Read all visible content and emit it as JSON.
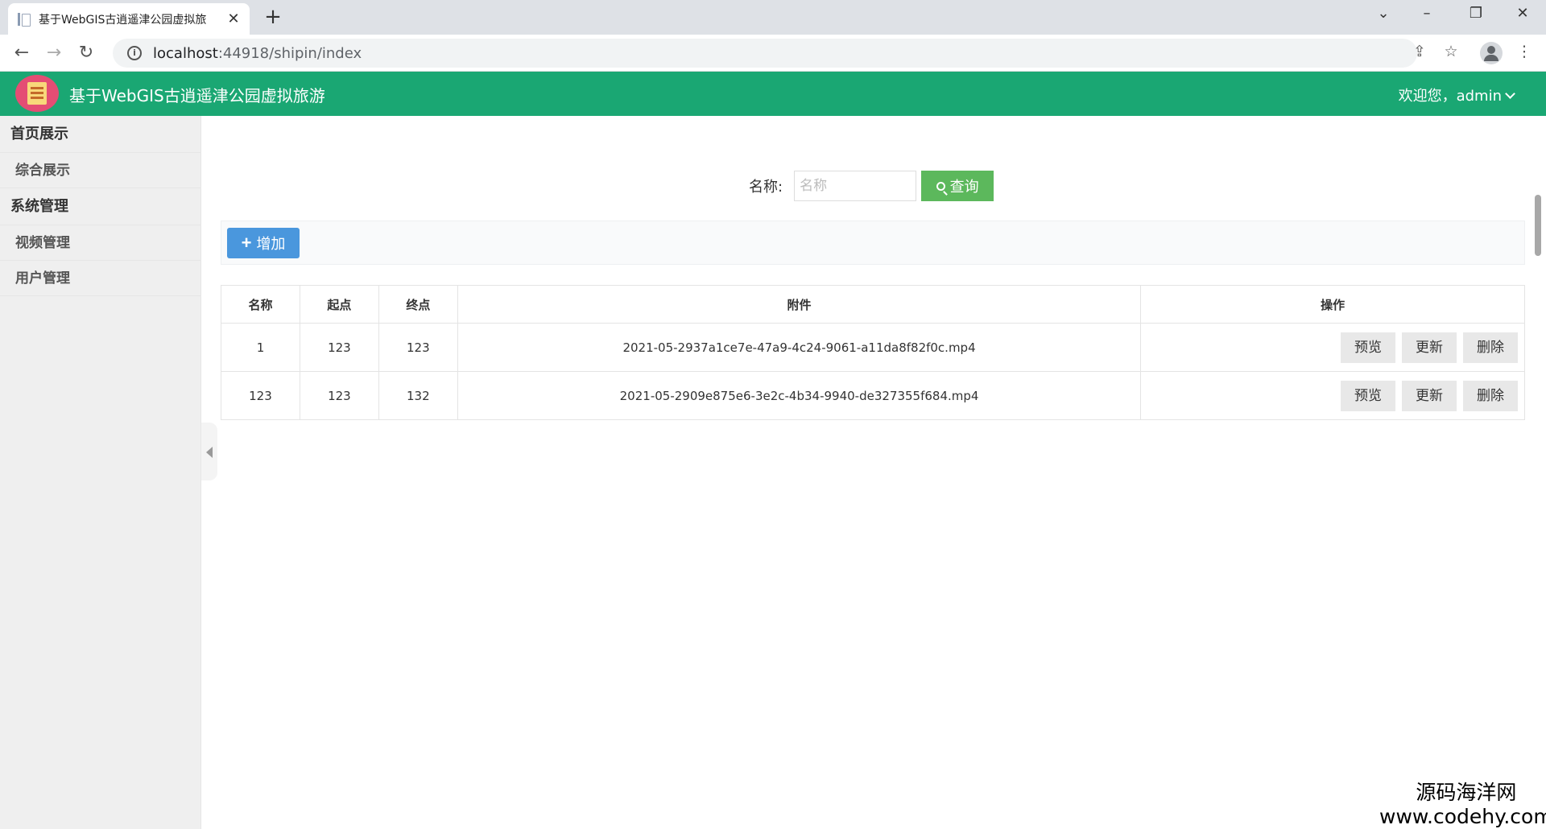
{
  "browser": {
    "tab_title": "基于WebGIS古逍遥津公园虚拟旅",
    "tab_close": "✕",
    "new_tab": "+",
    "url_host": "localhost",
    "url_path": ":44918/shipin/index",
    "window_controls": {
      "dropdown": "⌄",
      "minimize": "–",
      "restore": "❐",
      "close": "✕"
    }
  },
  "header": {
    "title": "基于WebGIS古逍遥津公园虚拟旅游",
    "user_greeting": "欢迎您，admin"
  },
  "sidebar": {
    "groups": [
      {
        "label": "首页展示",
        "items": [
          {
            "label": "综合展示"
          }
        ]
      },
      {
        "label": "系统管理",
        "items": [
          {
            "label": "视频管理"
          },
          {
            "label": "用户管理"
          }
        ]
      }
    ]
  },
  "search": {
    "label": "名称:",
    "placeholder": "名称",
    "button_label": "查询"
  },
  "toolbar": {
    "add_label": "增加"
  },
  "table": {
    "headers": [
      "名称",
      "起点",
      "终点",
      "附件",
      "操作"
    ],
    "rows": [
      {
        "name": "1",
        "start": "123",
        "end": "123",
        "attachment": "2021-05-2937a1ce7e-47a9-4c24-9061-a11da8f82f0c.mp4"
      },
      {
        "name": "123",
        "start": "123",
        "end": "132",
        "attachment": "2021-05-2909e875e6-3e2c-4b34-9940-de327355f684.mp4"
      }
    ],
    "actions": {
      "preview": "预览",
      "update": "更新",
      "delete": "删除"
    }
  },
  "watermark": {
    "line1": "源码海洋网",
    "line2": "www.codehy.com"
  },
  "colors": {
    "header_bg": "#1aa773",
    "search_btn": "#5cb85c",
    "add_btn": "#4a97dd"
  }
}
